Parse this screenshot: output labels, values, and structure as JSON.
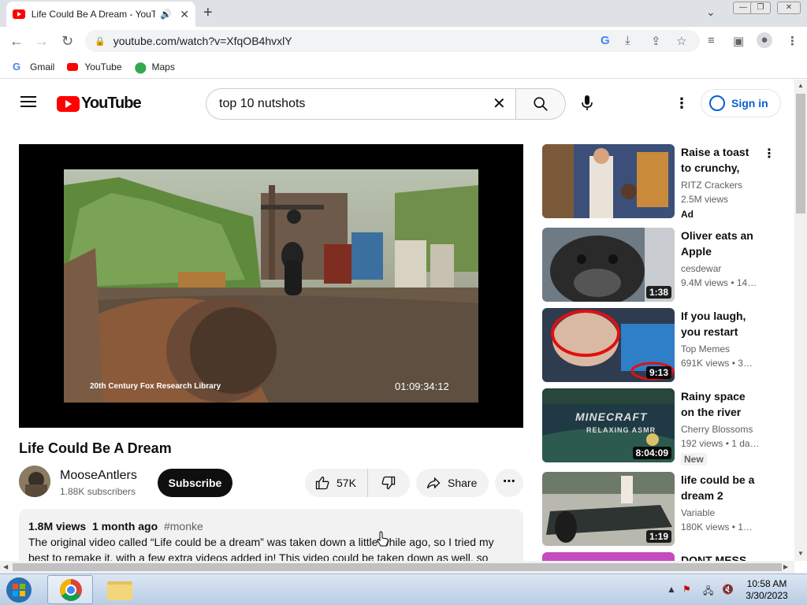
{
  "browser": {
    "tab_title": "Life Could Be A Dream - YouTube",
    "tab_audio_icon": "speaker-icon",
    "tab_close": "✕",
    "new_tab": "+",
    "url": "youtube.com/watch?v=XfqOB4hvxlY",
    "bookmarks": [
      {
        "label": "Gmail",
        "icon": "google-icon"
      },
      {
        "label": "YouTube",
        "icon": "youtube-icon"
      },
      {
        "label": "Maps",
        "icon": "maps-pin-icon"
      }
    ],
    "colors": {
      "accent": "#065fd4",
      "brand": "#ff0000"
    }
  },
  "youtube": {
    "logo_text": "YouTube",
    "search_query": "top 10 nutshots",
    "signin_label": "Sign in",
    "video": {
      "title": "Life Could Be A Dream",
      "credit": "20th Century Fox Research Library",
      "timecode": "01:09:34:12",
      "channel": "MooseAntlers",
      "subscribers": "1.88K subscribers",
      "subscribe_label": "Subscribe",
      "likes": "57K",
      "share_label": "Share",
      "views": "1.8M views",
      "age": "1 month ago",
      "hashtag": "#monke",
      "description": "The original video called “Life could be a dream” was taken down a little while ago, so I tried my best to remake it, with a few extra videos added in! This video could be taken down as well, so don't"
    },
    "recommendations": [
      {
        "title": "Raise a toast to crunchy, toast…",
        "channel": "RITZ Crackers",
        "views": "2.5M views",
        "badge": "Ad",
        "duration": ""
      },
      {
        "title": "Oliver eats an Apple",
        "channel": "cesdewar",
        "views": "9.4M views • 14…",
        "badge": "",
        "duration": "1:38"
      },
      {
        "title": "If you laugh, you restart th…",
        "channel": "Top Memes",
        "views": "691K views • 3…",
        "badge": "",
        "duration": "9:13"
      },
      {
        "title": "Rainy space on the river with…",
        "channel": "Cherry Blossoms",
        "views": "192 views • 1 da…",
        "badge": "New",
        "duration": "8:04:09",
        "thumb_text_1": "MINECRAFT",
        "thumb_text_2": "RELAXING ASMR"
      },
      {
        "title": "life could be a dream 2",
        "channel": "Variable",
        "views": "180K views • 1…",
        "badge": "",
        "duration": "1:19"
      },
      {
        "title": "DONT MESS…",
        "channel": "",
        "views": "",
        "badge": "",
        "duration": ""
      }
    ]
  },
  "taskbar": {
    "time": "10:58 AM",
    "date": "3/30/2023"
  }
}
